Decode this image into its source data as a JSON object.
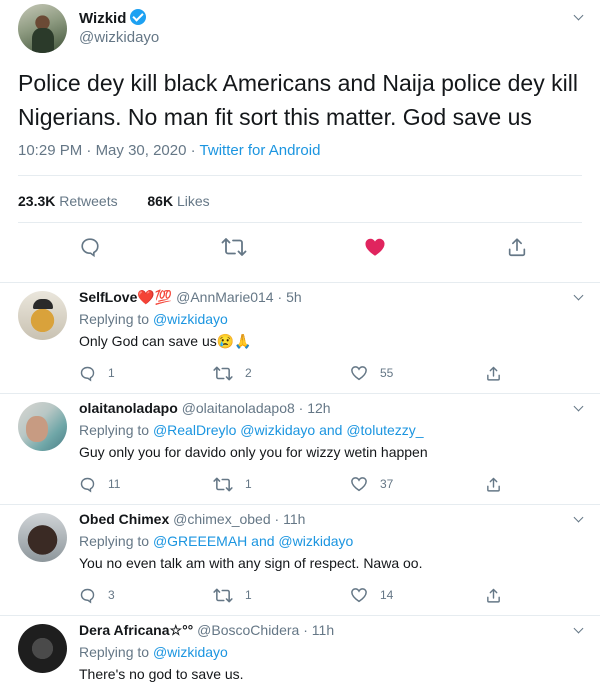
{
  "tweet": {
    "name": "Wizkid",
    "handle": "@wizkidayo",
    "text": "Police dey kill black Americans and Naija police dey kill Nigerians. No man fit sort this matter. God save us",
    "time": "10:29 PM",
    "sep": " · ",
    "date": "May 30, 2020",
    "source": "Twitter for Android",
    "retweets_count": "23.3K",
    "retweets_label": " Retweets",
    "likes_count": "86K",
    "likes_label": " Likes",
    "colors": {
      "link": "#1b95e0",
      "like": "#e0245e",
      "verified": "#1da1f2",
      "muted": "#657786"
    }
  },
  "replies": [
    {
      "name": "SelfLove❤️💯",
      "handle": "@AnnMarie014",
      "age": "5h",
      "replying_prefix": "Replying to ",
      "mentions": "@wizkidayo",
      "text": "Only God can save us😢🙏",
      "comments": "1",
      "retweets": "2",
      "likes": "55"
    },
    {
      "name": "olaitanoladapo",
      "handle": "@olaitanoladapo8",
      "age": "12h",
      "replying_prefix": "Replying to ",
      "mentions": "@RealDreylo @wizkidayo and @tolutezzy_",
      "text": "Guy only you for davido only you for wizzy wetin happen",
      "comments": "11",
      "retweets": "1",
      "likes": "37"
    },
    {
      "name": "Obed Chimex",
      "handle": "@chimex_obed",
      "age": "11h",
      "replying_prefix": "Replying to ",
      "mentions": "@GREEEMAH and @wizkidayo",
      "text": "You no even talk am with any sign of respect. Nawa oo.",
      "comments": "3",
      "retweets": "1",
      "likes": "14"
    },
    {
      "name": "Dera Africana☆°°",
      "handle": "@BoscoChidera",
      "age": "11h",
      "replying_prefix": "Replying to ",
      "mentions": "@wizkidayo",
      "text": "There's no god to save us."
    }
  ]
}
